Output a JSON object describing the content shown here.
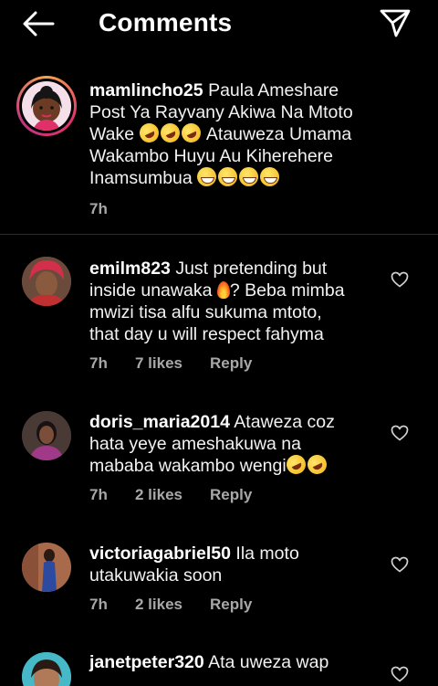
{
  "header": {
    "title": "Comments",
    "back_icon": "back-arrow-icon",
    "send_icon": "paper-plane-icon"
  },
  "caption": {
    "username": "mamlincho25",
    "text_1": "Paula Ameshare",
    "text_2": "Post Ya Rayvany Akiwa Na Mtoto",
    "text_3": "Wake",
    "text_4": "Atauweza Umama",
    "text_5": "Wakambo Huyu Au Kiherehere",
    "text_6": "Inamsumbua",
    "time": "7h"
  },
  "comments": [
    {
      "username": "emilm823",
      "text_1": "Just pretending but",
      "text_2": "inside unawaka",
      "text_2b": "? Beba mimba",
      "text_3": "mwizi tisa alfu sukuma mtoto,",
      "text_4": "that day u will respect fahyma",
      "time": "7h",
      "likes": "7 likes",
      "reply": "Reply"
    },
    {
      "username": "doris_maria2014",
      "text_1": "Ataweza coz",
      "text_2": "hata yeye ameshakuwa na",
      "text_3": "mababa wakambo wengi",
      "time": "7h",
      "likes": "2 likes",
      "reply": "Reply"
    },
    {
      "username": "victoriagabriel50",
      "text_1": "Ila moto",
      "text_2": "utakuwakia soon",
      "time": "7h",
      "likes": "2 likes",
      "reply": "Reply"
    },
    {
      "username": "janetpeter320",
      "text_1": "Ata uweza wap"
    }
  ],
  "colors": {
    "background": "#000000",
    "text": "#ffffff",
    "meta": "#a8a8a8",
    "divider": "#2c2c2c"
  }
}
